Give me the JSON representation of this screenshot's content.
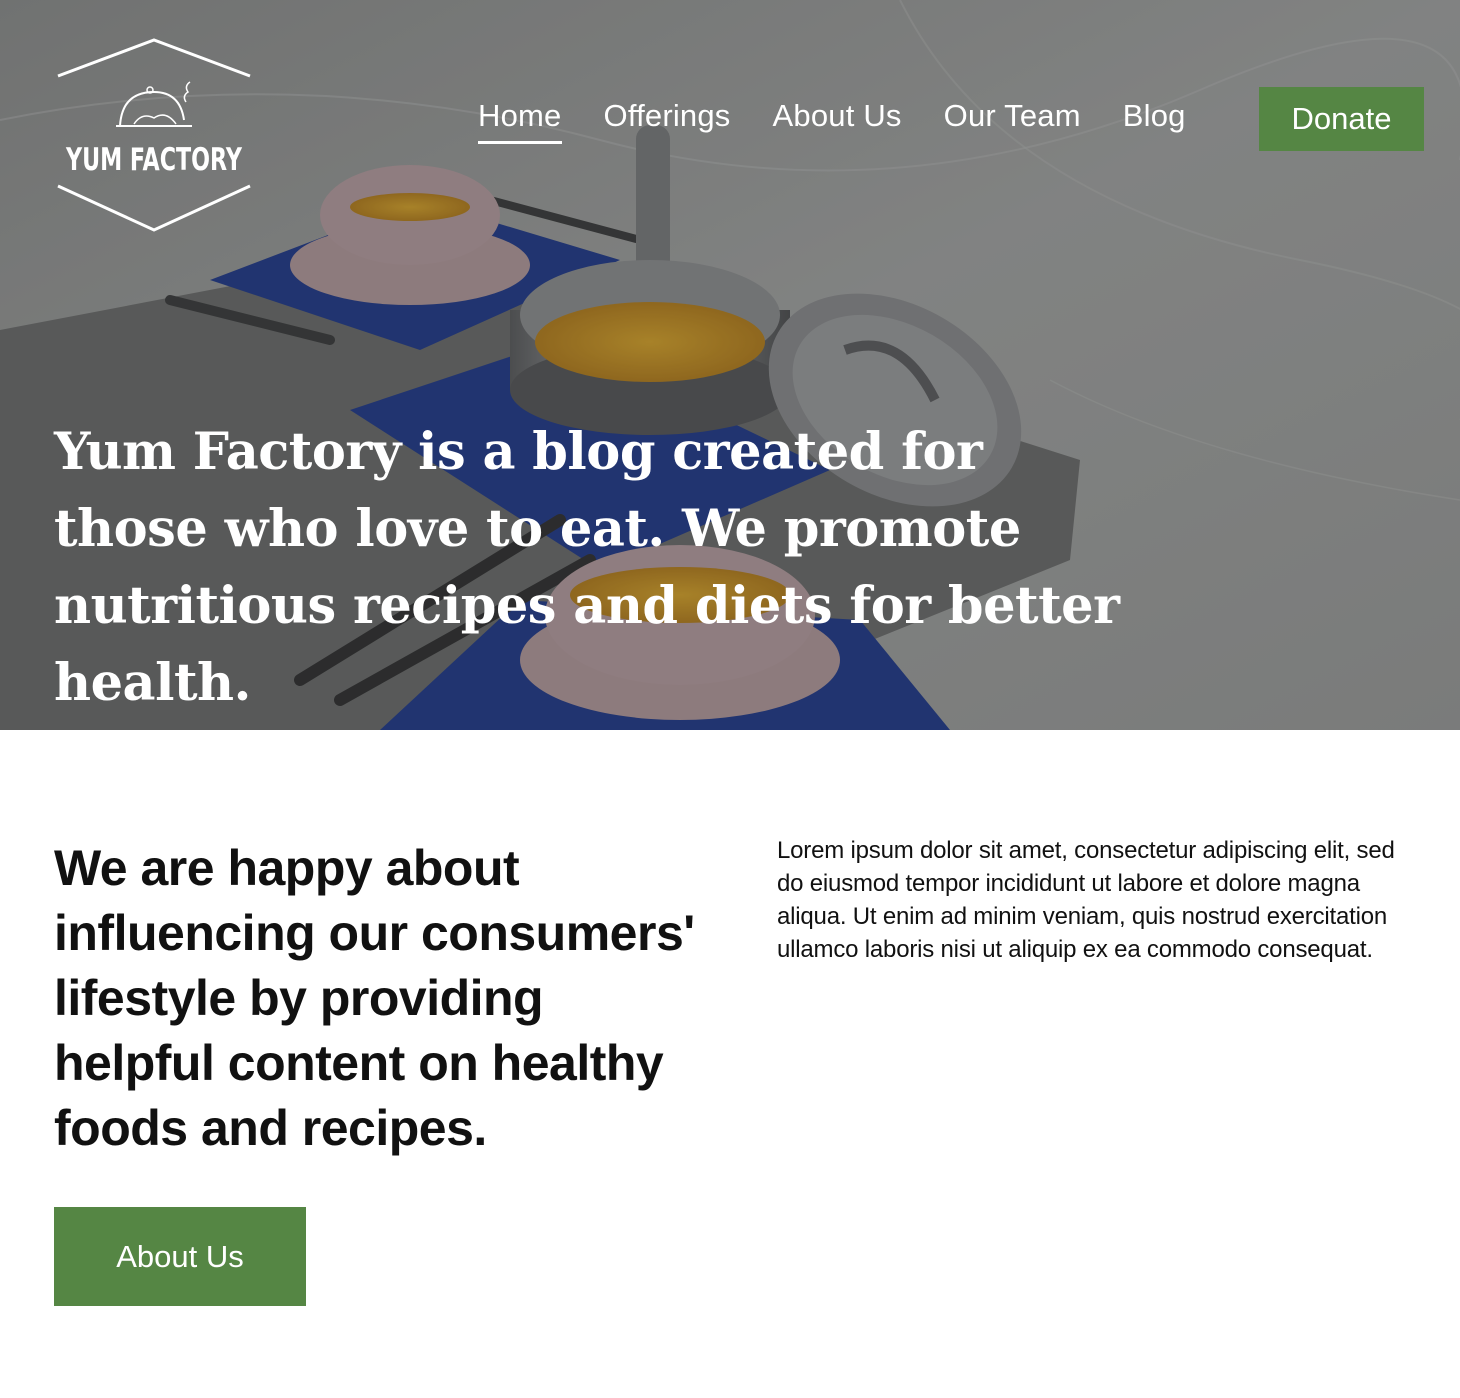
{
  "brand": {
    "logo_text": "YUM FACTORY"
  },
  "nav": {
    "items": [
      {
        "label": "Home",
        "active": true
      },
      {
        "label": "Offerings"
      },
      {
        "label": "About Us"
      },
      {
        "label": "Our Team"
      },
      {
        "label": "Blog"
      }
    ],
    "donate_label": "Donate"
  },
  "hero": {
    "headline": "Yum Factory is a blog created for those who love to eat. We promote nutritious recipes and diets for better health."
  },
  "intro": {
    "heading": "We are happy about influencing our consumers' lifestyle by providing helpful content on healthy foods and recipes.",
    "body": "Lorem ipsum dolor sit amet, consectetur adipiscing elit, sed do eiusmod tempor incididunt ut labore et dolore magna aliqua. Ut enim ad minim veniam, quis nostrud exercitation ullamco laboris nisi ut aliquip ex ea commodo consequat.",
    "button_label": "About Us"
  },
  "colors": {
    "accent": "#558644",
    "text": "#111111",
    "hero_text": "#ffffff"
  }
}
